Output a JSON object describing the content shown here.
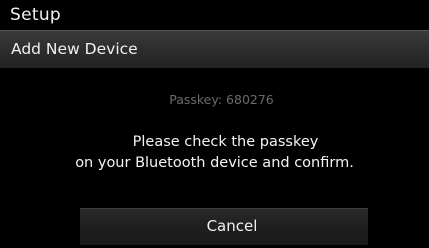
{
  "title_bar": {
    "title": "Setup"
  },
  "header": {
    "title": "Add New Device"
  },
  "dialog": {
    "passkey_text": "Passkey: 680276",
    "message_line1": "Please check the passkey",
    "message_line2": "on your Bluetooth device and confirm.",
    "cancel_label": "Cancel"
  }
}
